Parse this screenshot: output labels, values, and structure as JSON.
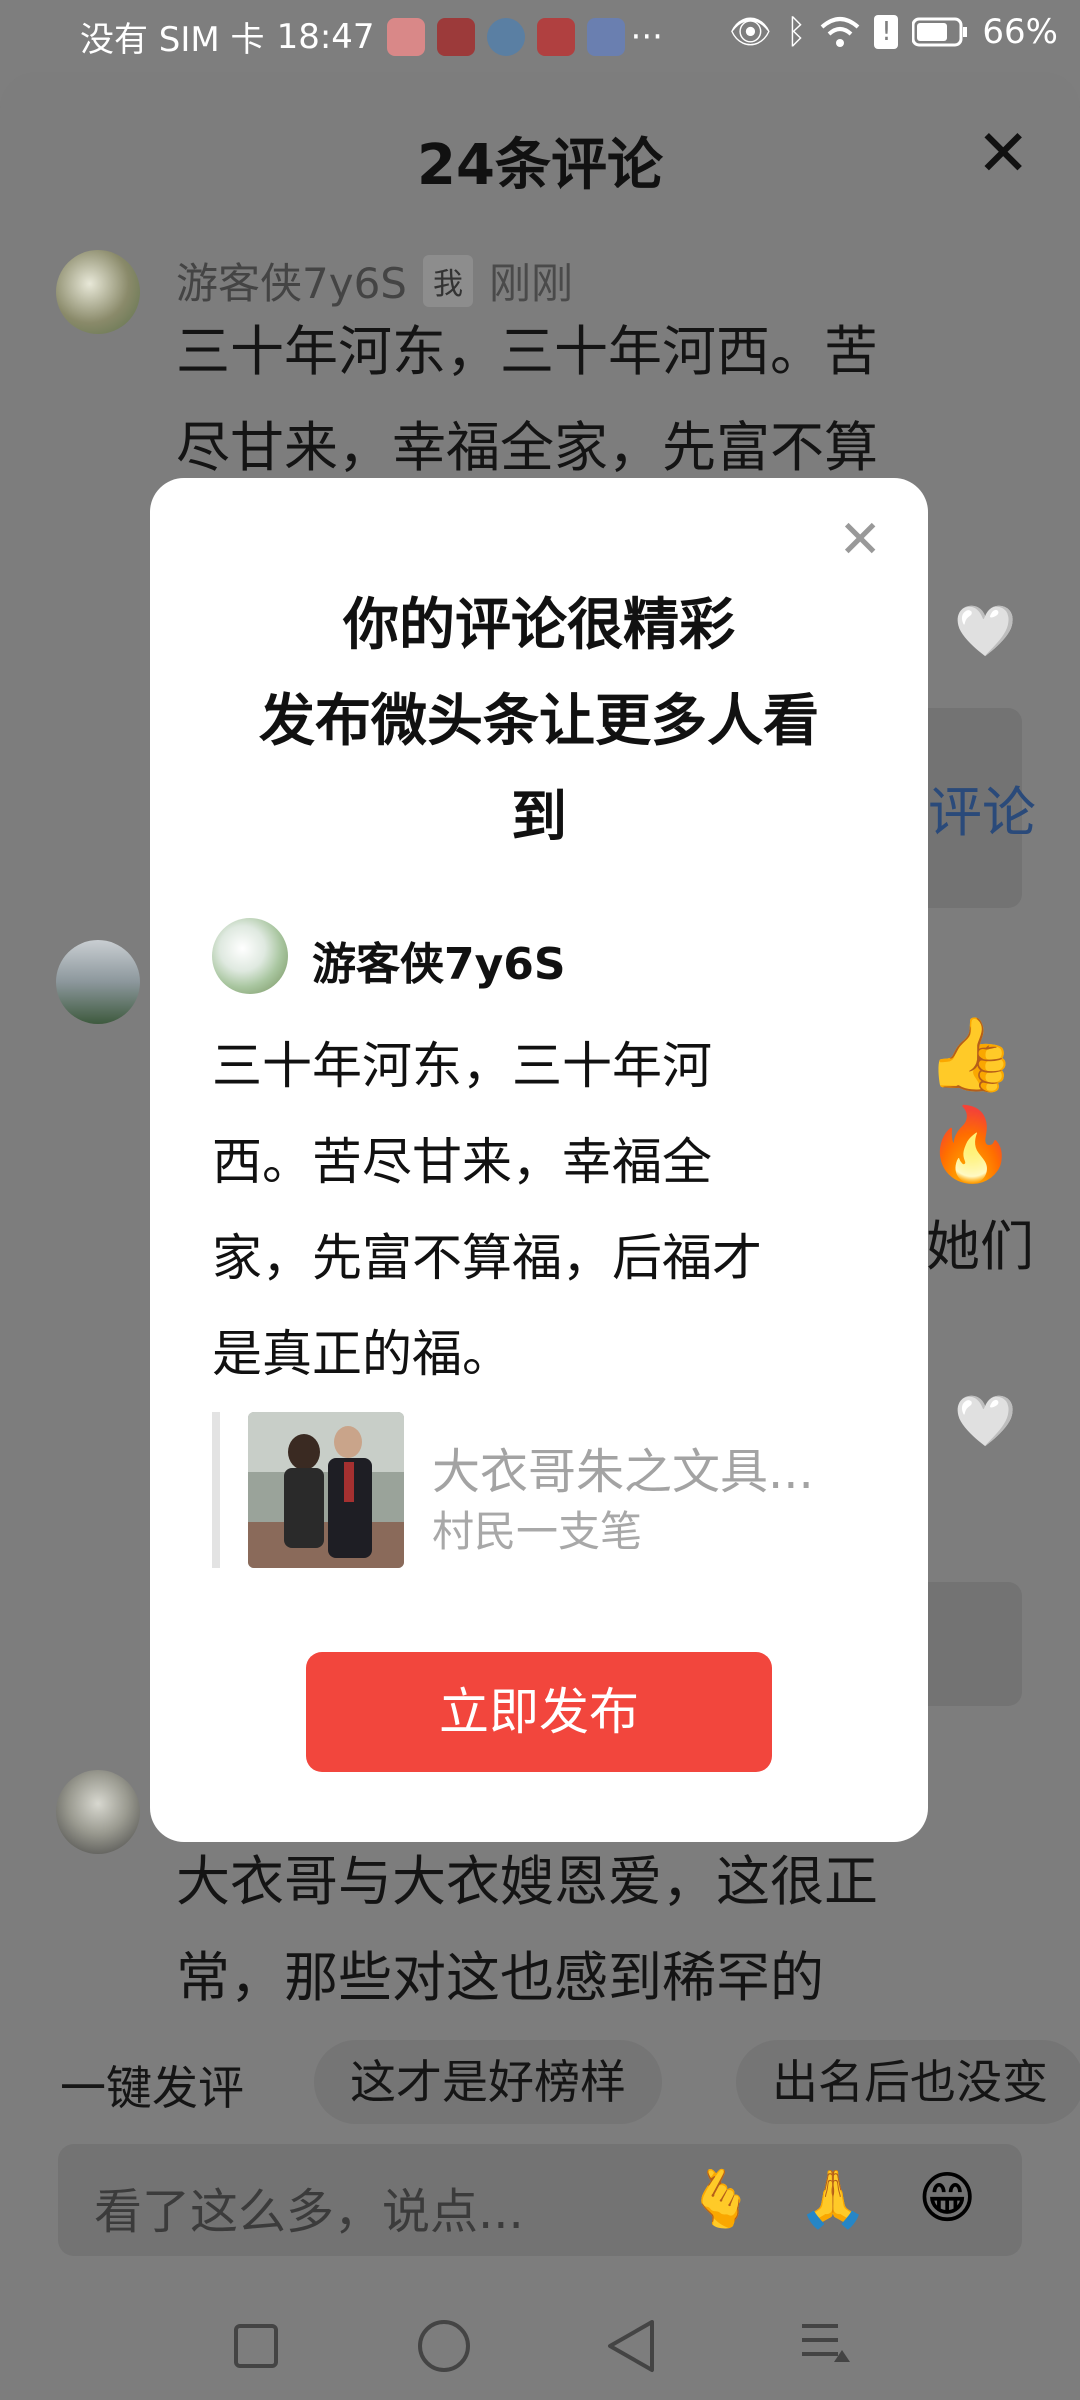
{
  "status_bar": {
    "sim": "没有 SIM 卡",
    "time": "18:47",
    "dots": "···",
    "battery": "66%"
  },
  "sheet": {
    "title": "24条评论"
  },
  "comments": [
    {
      "user": "游客侠7y6S",
      "tag": "我",
      "time": "刚刚",
      "text_lines": [
        "三十年河东，三十年河西。苦",
        "尽甘来，幸福全家，先富不算"
      ]
    },
    {
      "partial_fragments": [
        "评论",
        "她们"
      ]
    },
    {
      "text_lines": [
        "大衣哥与大衣嫂恩爱，这很正",
        "常，那些对这也感到稀罕的"
      ]
    }
  ],
  "quick_replies": {
    "lead": "一键发评",
    "chips": [
      "这才是好榜样",
      "出名后也没变"
    ]
  },
  "input": {
    "placeholder": "看了这么多，说点...",
    "emojis": [
      "🫰",
      "🙏",
      "😁"
    ]
  },
  "modal": {
    "title_lines": [
      "你的评论很精彩",
      "发布微头条让更多人看",
      "到"
    ],
    "user": "游客侠7y6S",
    "text_lines": [
      "三十年河东，三十年河",
      "西。苦尽甘来，幸福全",
      "家，先富不算福，后福才",
      "是真正的福。"
    ],
    "quote": {
      "title": "大衣哥朱之文具...",
      "author": "村民一支笔"
    },
    "button": "立即发布"
  }
}
